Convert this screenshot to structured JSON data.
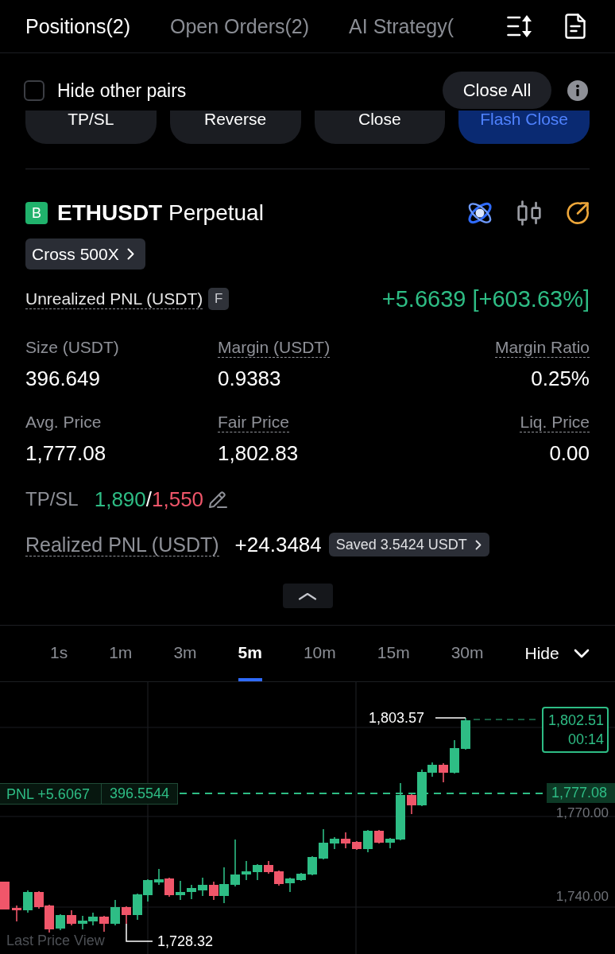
{
  "tabs": [
    {
      "label": "Positions(2)",
      "selected": true
    },
    {
      "label": "Open Orders(2)",
      "selected": false
    },
    {
      "label": "AI Strategy(",
      "selected": false
    }
  ],
  "filter": {
    "label": "Hide other pairs",
    "checked": false
  },
  "close_all": "Close All",
  "actions": [
    {
      "label": "TP/SL",
      "kind": "secondary"
    },
    {
      "label": "Reverse",
      "kind": "secondary"
    },
    {
      "label": "Close",
      "kind": "secondary"
    },
    {
      "label": "Flash Close",
      "kind": "primary"
    }
  ],
  "position": {
    "side": "B",
    "title": "**ETHUSDT** Perpetual",
    "margin_mode": "Cross 500X",
    "unrealized_label": "Unrealized PNL (USDT)",
    "unrealized_tag": "F",
    "unrealized_value": "+5.6639 [+603.63%]",
    "stats": [
      {
        "label": "Size (USDT)",
        "value": "396.649",
        "underlined": false
      },
      {
        "label": "Margin (USDT)",
        "value": "0.9383",
        "underlined": true
      },
      {
        "label": "Margin Ratio",
        "value": "0.25%",
        "underlined": true
      },
      {
        "label": "Avg. Price",
        "value": "1,777.08",
        "underlined": false
      },
      {
        "label": "Fair Price",
        "value": "1,802.83",
        "underlined": true
      },
      {
        "label": "Liq. Price",
        "value": "0.00",
        "underlined": true
      }
    ],
    "tpsl": {
      "label": "TP/SL",
      "take_profit": "1,890",
      "separator": "/",
      "stop_loss": "1,550"
    },
    "realized": {
      "label": "Realized PNL (USDT)",
      "value": "+24.3484",
      "saved": "Saved 3.5424 USDT"
    }
  },
  "timeframes": [
    {
      "label": "1s",
      "selected": false
    },
    {
      "label": "1m",
      "selected": false
    },
    {
      "label": "3m",
      "selected": false
    },
    {
      "label": "5m",
      "selected": true
    },
    {
      "label": "10m",
      "selected": false
    },
    {
      "label": "15m",
      "selected": false
    },
    {
      "label": "30m",
      "selected": false
    }
  ],
  "hide": "Hide",
  "chart": {
    "high_label": "1,803.57",
    "low_label": "1,728.32",
    "last_price": "1,802.51",
    "countdown": "00:14",
    "pnl": "PNL +5.6067",
    "position_size": "396.5544",
    "entry_price": "1,777.08",
    "y_axis": [
      "1,770.00",
      "1,740.00"
    ],
    "view_mode": "Last Price View"
  }
}
